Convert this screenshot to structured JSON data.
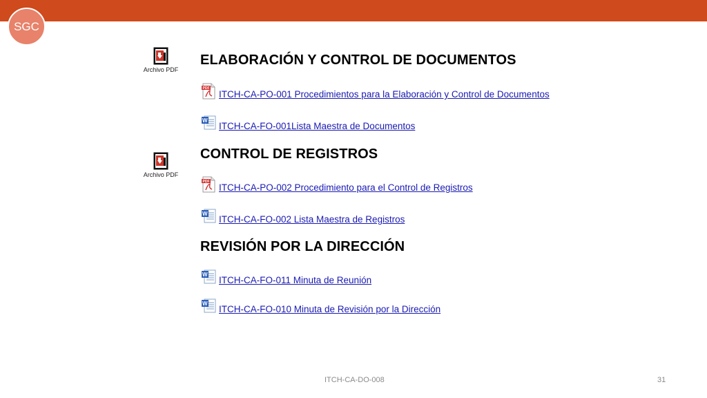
{
  "logo": {
    "text": "SGC"
  },
  "attachments": [
    {
      "label": "Archivo PDF",
      "icon": "pdf-attachment-icon"
    },
    {
      "label": "Archivo PDF",
      "icon": "pdf-attachment-icon"
    }
  ],
  "sections": [
    {
      "title": "ELABORACIÓN Y CONTROL DE DOCUMENTOS",
      "links": [
        {
          "icon": "pdf-icon",
          "text": " ITCH-CA-PO-001 Procedimientos para la Elaboración y Control de Documentos"
        },
        {
          "icon": "word-icon",
          "text": "ITCH-CA-FO-001Lista Maestra de Documentos"
        }
      ]
    },
    {
      "title": "CONTROL DE REGISTROS",
      "links": [
        {
          "icon": "pdf-icon",
          "text": " ITCH-CA-PO-002 Procedimiento para el Control de Registros"
        },
        {
          "icon": "word-icon",
          "text": "ITCH-CA-FO-002 Lista Maestra de Registros"
        }
      ]
    },
    {
      "title": "REVISIÓN POR LA DIRECCIÓN",
      "links": [
        {
          "icon": "word-icon",
          "text": "ITCH-CA-FO-011 Minuta de Reunión"
        },
        {
          "icon": "word-icon",
          "text": "ITCH-CA-FO-010 Minuta de Revisión por la Dirección"
        }
      ]
    }
  ],
  "footer": {
    "doc_code": "ITCH-CA-DO-008",
    "page_number": "31"
  },
  "colors": {
    "top_bar": "#cf4a1c",
    "logo_circle": "#e8826a",
    "link": "#1a1ab3"
  }
}
